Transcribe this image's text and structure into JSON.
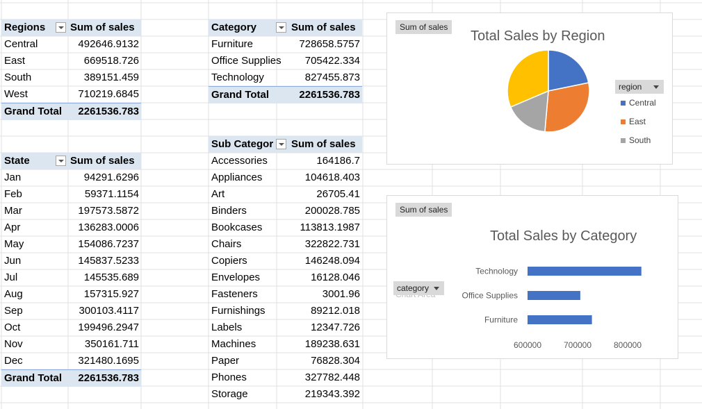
{
  "regions_pivot": {
    "header": [
      "Regions",
      "Sum of sales"
    ],
    "rows": [
      [
        "Central",
        "492646.9132"
      ],
      [
        "East",
        "669518.726"
      ],
      [
        "South",
        "389151.459"
      ],
      [
        "West",
        "710219.6845"
      ]
    ],
    "total": [
      "Grand Total",
      "2261536.783"
    ]
  },
  "state_pivot": {
    "header": [
      "State",
      "Sum of sales"
    ],
    "rows": [
      [
        "Jan",
        "94291.6296"
      ],
      [
        "Feb",
        "59371.1154"
      ],
      [
        "Mar",
        "197573.5872"
      ],
      [
        "Apr",
        "136283.0006"
      ],
      [
        "May",
        "154086.7237"
      ],
      [
        "Jun",
        "145837.5233"
      ],
      [
        "Jul",
        "145535.689"
      ],
      [
        "Aug",
        "157315.927"
      ],
      [
        "Sep",
        "300103.4117"
      ],
      [
        "Oct",
        "199496.2947"
      ],
      [
        "Nov",
        "350161.711"
      ],
      [
        "Dec",
        "321480.1695"
      ]
    ],
    "total": [
      "Grand Total",
      "2261536.783"
    ]
  },
  "category_pivot": {
    "header": [
      "Category",
      "Sum of sales"
    ],
    "rows": [
      [
        "Furniture",
        "728658.5757"
      ],
      [
        "Office Supplies",
        "705422.334"
      ],
      [
        "Technology",
        "827455.873"
      ]
    ],
    "total": [
      "Grand Total",
      "2261536.783"
    ]
  },
  "subcategory_pivot": {
    "header": [
      "Sub Categor",
      "Sum of sales"
    ],
    "rows": [
      [
        "Accessories",
        "164186.7"
      ],
      [
        "Appliances",
        "104618.403"
      ],
      [
        "Art",
        "26705.41"
      ],
      [
        "Binders",
        "200028.785"
      ],
      [
        "Bookcases",
        "113813.1987"
      ],
      [
        "Chairs",
        "322822.731"
      ],
      [
        "Copiers",
        "146248.094"
      ],
      [
        "Envelopes",
        "16128.046"
      ],
      [
        "Fasteners",
        "3001.96"
      ],
      [
        "Furnishings",
        "89212.018"
      ],
      [
        "Labels",
        "12347.726"
      ],
      [
        "Machines",
        "189238.631"
      ],
      [
        "Paper",
        "76828.304"
      ],
      [
        "Phones",
        "327782.448"
      ],
      [
        "Storage",
        "219343.392"
      ]
    ]
  },
  "pie_chart": {
    "field_button": "Sum of sales",
    "title": "Total Sales by Region",
    "legend_filter": "region",
    "legend": [
      "Central",
      "East",
      "South"
    ],
    "colors": [
      "#4472c4",
      "#ed7d31",
      "#a5a5a5",
      "#ffc000"
    ]
  },
  "bar_chart": {
    "field_button": "Sum of sales",
    "title": "Total Sales by Category",
    "axis_filter": "category",
    "hidden_label": "Chart Area",
    "color": "#4472c4"
  },
  "chart_data": [
    {
      "type": "pie",
      "title": "Total Sales by Region",
      "categories": [
        "Central",
        "East",
        "South",
        "West"
      ],
      "values": [
        492646.9132,
        669518.726,
        389151.459,
        710219.6845
      ]
    },
    {
      "type": "bar",
      "orientation": "horizontal",
      "title": "Total Sales by Category",
      "categories": [
        "Furniture",
        "Office Supplies",
        "Technology"
      ],
      "values": [
        728658.5757,
        705422.334,
        827455.873
      ],
      "xlim": [
        600000,
        800000
      ],
      "xticks": [
        "600000",
        "700000",
        "800000"
      ]
    }
  ]
}
